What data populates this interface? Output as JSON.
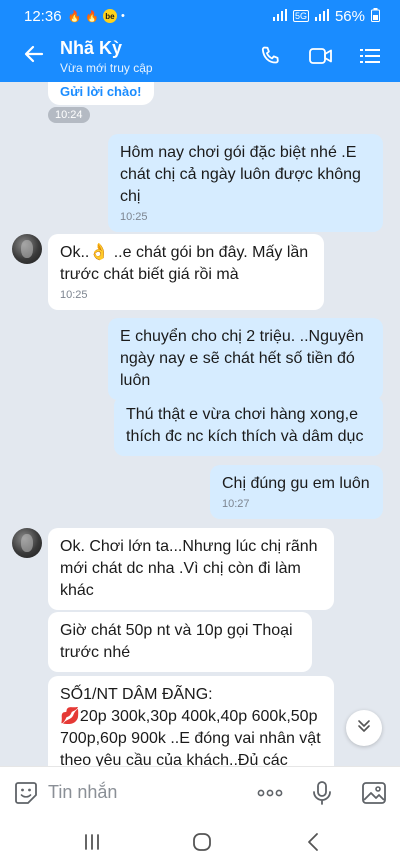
{
  "status_bar": {
    "time": "12:36",
    "network": "5G",
    "battery": "56%"
  },
  "header": {
    "title": "Nhã Kỳ",
    "subtitle": "Vừa mới truy cập"
  },
  "chat": {
    "greet_label": "Gửi lời chào!",
    "greet_time": "10:24",
    "messages": [
      {
        "side": "out",
        "text": "Hôm nay chơi gói đặc biệt nhé .E chát chị cả ngày luôn được không chị",
        "time": "10:25"
      },
      {
        "side": "in",
        "text": "Ok..👌 ..e chát gói bn đây. Mấy lần trước chát biết giá rồi mà",
        "time": "10:25"
      },
      {
        "side": "out",
        "text": "E chuyển cho chị 2 triệu. ..Nguyên ngày nay e sẽ chát hết số tiền đó luôn",
        "time": ""
      },
      {
        "side": "out",
        "text": "Thú thật e vừa chơi hàng xong,e thích đc nc kích thích và dâm dục",
        "time": ""
      },
      {
        "side": "out",
        "text": "Chị đúng gu em luôn",
        "time": "10:27"
      },
      {
        "side": "in",
        "text": "Ok. Chơi lớn ta...Nhưng lúc chị rãnh mới chát dc nha .Vì chị còn đi làm khác",
        "time": ""
      },
      {
        "side": "in",
        "text": "Giờ chát 50p nt và 10p gọi Thoại trước nhé",
        "time": ""
      },
      {
        "side": "in",
        "heading": "SỐ1/NT DÂM ĐÃNG:",
        "emoji": "💋",
        "text": "20p 300k,30p 400k,40p 600k,50p 700p,60p 900k ..E đóng vai nhân vật theo yêu cầu của khách..Đủ các",
        "time": ""
      }
    ]
  },
  "input": {
    "placeholder": "Tin nhắn"
  }
}
